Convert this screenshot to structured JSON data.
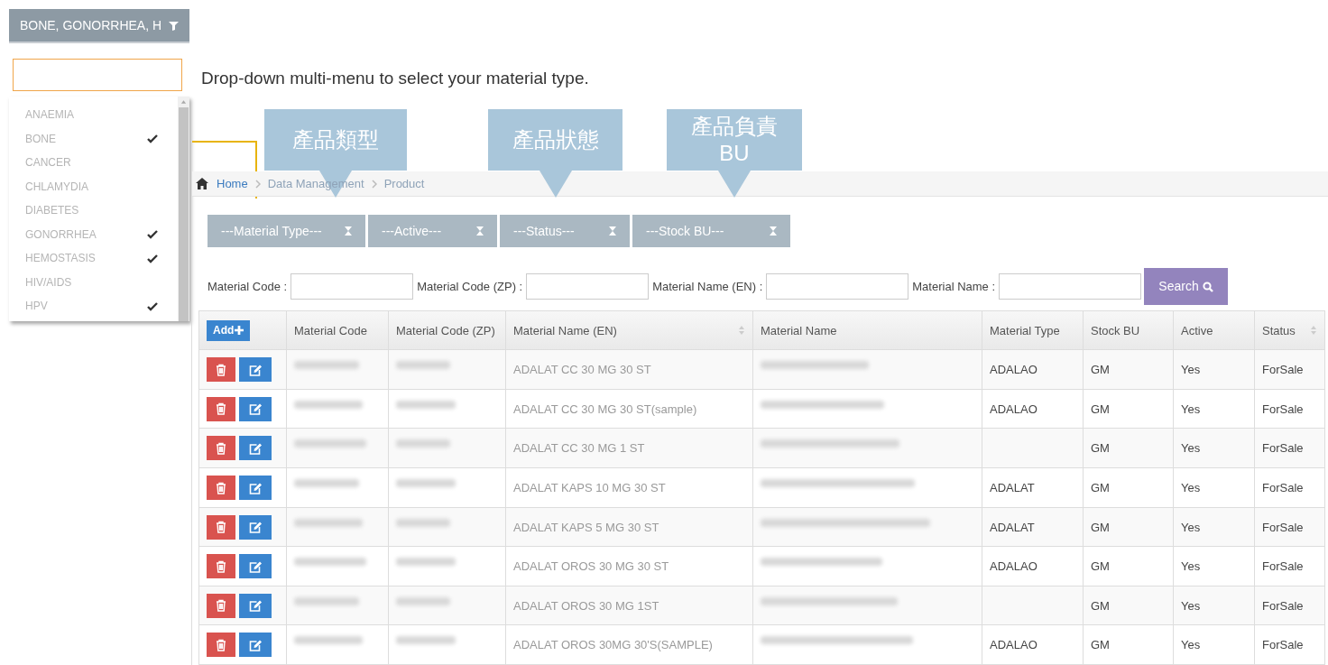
{
  "dropdown": {
    "summary": "BONE, GONORRHEA, H",
    "options": [
      {
        "label": "ANAEMIA",
        "checked": false
      },
      {
        "label": "BONE",
        "checked": true
      },
      {
        "label": "CANCER",
        "checked": false
      },
      {
        "label": "CHLAMYDIA",
        "checked": false
      },
      {
        "label": "DIABETES",
        "checked": false
      },
      {
        "label": "GONORRHEA",
        "checked": true
      },
      {
        "label": "HEMOSTASIS",
        "checked": true
      },
      {
        "label": "HIV/AIDS",
        "checked": false
      },
      {
        "label": "HPV",
        "checked": true
      }
    ]
  },
  "caption": "Drop-down multi-menu to select your material type.",
  "callouts": [
    {
      "text": "產品類型"
    },
    {
      "text": "產品狀態"
    },
    {
      "text": "產品負責 BU"
    }
  ],
  "breadcrumb": [
    "Home",
    "Data Management",
    "Product"
  ],
  "filters": [
    "---Material Type---",
    "---Active---",
    "---Status---",
    "---Stock BU---"
  ],
  "search_fields": [
    {
      "label": "Material Code :"
    },
    {
      "label": "Material Code (ZP) :"
    },
    {
      "label": "Material Name (EN) :"
    },
    {
      "label": "Material Name :"
    }
  ],
  "search_button": "Search",
  "table": {
    "add_button": "Add",
    "columns": [
      {
        "label": "Material Code",
        "sortable": false
      },
      {
        "label": "Material Code (ZP)",
        "sortable": false
      },
      {
        "label": "Material Name (EN)",
        "sortable": true
      },
      {
        "label": "Material Name",
        "sortable": false
      },
      {
        "label": "Material Type",
        "sortable": false
      },
      {
        "label": "Stock BU",
        "sortable": false
      },
      {
        "label": "Active",
        "sortable": false
      },
      {
        "label": "Status",
        "sortable": true
      }
    ],
    "rows": [
      {
        "name_en": "ADALAT CC 30 MG 30 ST",
        "type": "ADALAO",
        "stock_bu": "GM",
        "active": "Yes",
        "status": "ForSale"
      },
      {
        "name_en": "ADALAT CC 30 MG 30 ST(sample)",
        "type": "ADALAO",
        "stock_bu": "GM",
        "active": "Yes",
        "status": "ForSale"
      },
      {
        "name_en": "ADALAT CC 30 MG 1 ST",
        "stock_bu": "GM",
        "active": "Yes",
        "status": "ForSale"
      },
      {
        "name_en": "ADALAT KAPS 10 MG 30 ST",
        "type": "ADALAT",
        "stock_bu": "GM",
        "active": "Yes",
        "status": "ForSale"
      },
      {
        "name_en": "ADALAT KAPS 5 MG 30 ST",
        "type": "ADALAT",
        "stock_bu": "GM",
        "active": "Yes",
        "status": "ForSale"
      },
      {
        "name_en": "ADALAT OROS 30 MG 30 ST",
        "type": "ADALAO",
        "stock_bu": "GM",
        "active": "Yes",
        "status": "ForSale"
      },
      {
        "name_en": "ADALAT OROS 30 MG 1ST",
        "stock_bu": "GM",
        "active": "Yes",
        "status": "ForSale"
      },
      {
        "name_en": "ADALAT OROS 30MG 30'S(SAMPLE)",
        "type": "ADALAO",
        "stock_bu": "GM",
        "active": "Yes",
        "status": "ForSale"
      }
    ]
  }
}
